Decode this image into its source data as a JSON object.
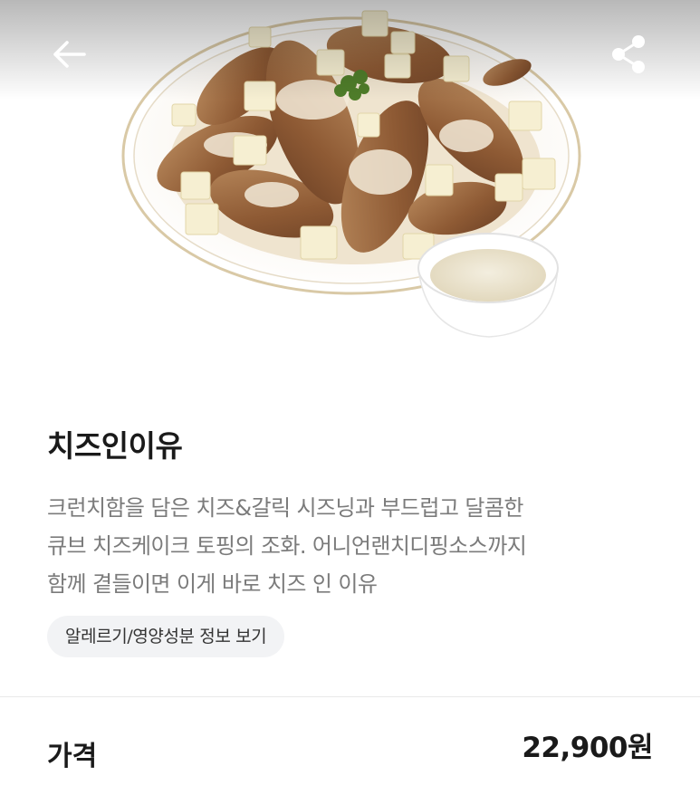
{
  "nav": {
    "back_icon": "arrow-left-icon",
    "share_icon": "share-icon"
  },
  "product": {
    "image_alt": "",
    "name": "치즈인이유",
    "description_lines": [
      "크런치함을 담은 치즈&갈릭 시즈닝과 부드럽고 달콤한",
      "큐브 치즈케이크 토핑의 조화. 어니언랜치디핑소스까지",
      "함께 곁들이면 이게 바로 치즈 인 이유"
    ],
    "info_button_label": "알레르기/영양성분 정보 보기"
  },
  "price": {
    "label": "가격",
    "value": "22,900원"
  },
  "colors": {
    "text_primary": "#1a1a1a",
    "text_secondary": "#7b7b7b",
    "chip_bg": "#f2f3f5",
    "divider": "#e9e9e9"
  }
}
